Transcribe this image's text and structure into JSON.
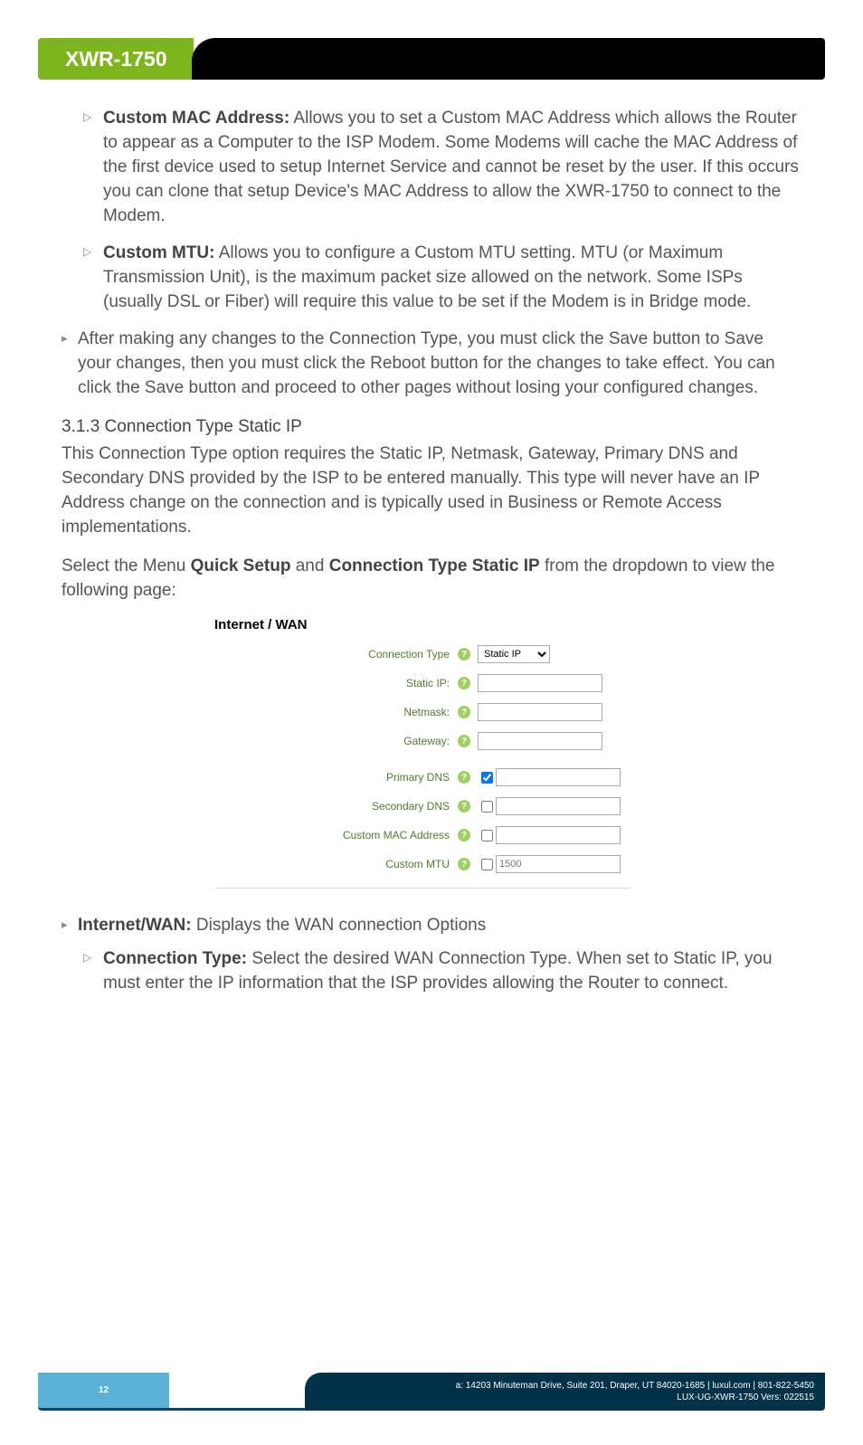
{
  "header": {
    "title": "XWR-1750"
  },
  "items": {
    "customMac": {
      "label": "Custom MAC Address:",
      "text": " Allows you to set a Custom MAC Address which allows the Router to appear as a Computer to the ISP Modem. Some Modems will cache the MAC Address of the first device used to setup Internet Service and cannot be reset by the user. If this occurs you can clone that setup Device's MAC Address to allow the XWR-1750 to connect to the Modem."
    },
    "customMtu": {
      "label": "Custom MTU:",
      "text": " Allows you to configure a Custom MTU setting. MTU (or Maximum Transmission Unit), is the maximum packet size allowed on the network. Some ISPs (usually DSL or Fiber) will require this value to be set if the Modem is in Bridge mode."
    },
    "afterChanges": "After making any changes to the Connection Type, you must click the Save button to Save your changes, then you must click the Reboot button for the changes to take effect. You can click the Save button and proceed to other pages without losing your configured changes."
  },
  "section": {
    "heading": "3.1.3 Connection Type Static IP",
    "para1": "This Connection Type option requires the Static IP, Netmask, Gateway, Primary DNS and Secondary DNS provided by the ISP to be entered manually. This type will never have an IP Address change on the connection and is typically used in Business or Remote Access implementations.",
    "para2a": "Select the Menu ",
    "para2b": "Quick Setup",
    "para2c": " and ",
    "para2d": "Connection Type Static IP",
    "para2e": " from the dropdown to view the following page:"
  },
  "screenshot": {
    "title": "Internet / WAN",
    "rows": {
      "connectionType": {
        "label": "Connection Type",
        "value": "Static IP"
      },
      "staticIp": {
        "label": "Static IP:"
      },
      "netmask": {
        "label": "Netmask:"
      },
      "gateway": {
        "label": "Gateway:"
      },
      "primaryDns": {
        "label": "Primary DNS"
      },
      "secondaryDns": {
        "label": "Secondary DNS"
      },
      "customMac": {
        "label": "Custom MAC Address"
      },
      "customMtu": {
        "label": "Custom MTU",
        "placeholder": "1500"
      }
    }
  },
  "items2": {
    "internetWan": {
      "label": "Internet/WAN:",
      "text": " Displays the WAN connection Options"
    },
    "connectionType": {
      "label": "Connection Type:",
      "text": " Select the desired WAN Connection Type. When set to Static IP, you must enter the IP information that the ISP provides allowing the Router to connect."
    }
  },
  "footer": {
    "page": "12",
    "address": "a: 14203 Minuteman Drive, Suite 201, Draper, UT 84020-1685 | luxul.com | 801-822-5450",
    "doc": "LUX-UG-XWR-1750  Vers: 022515"
  }
}
